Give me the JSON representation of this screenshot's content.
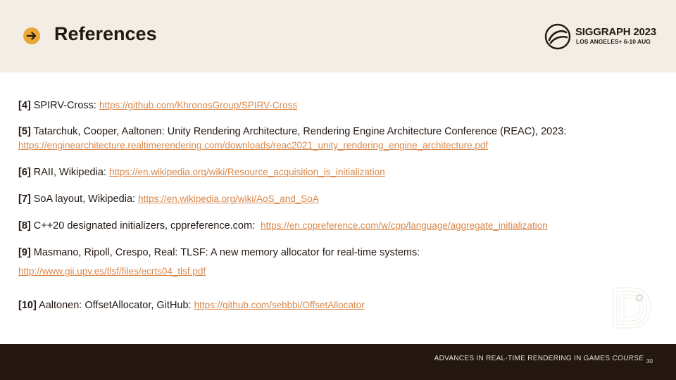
{
  "header": {
    "title": "References",
    "logo_name": "SIGGRAPH 2023",
    "logo_sub": "LOS ANGELES+ 6-10 AUG"
  },
  "colors": {
    "header_bg": "#f4ede5",
    "accent": "#e8a838",
    "link": "#d9874a",
    "footer_bg": "#231710"
  },
  "references": [
    {
      "num": "[4]",
      "text": "SPIRV-Cross:",
      "link": "https://github.com/KhronosGroup/SPIRV-Cross"
    },
    {
      "num": "[5]",
      "text": "Tatarchuk, Cooper, Aaltonen: Unity Rendering Architecture, Rendering Engine Architecture Conference (REAC), 2023:",
      "link": "https://enginearchitecture.realtimerendering.com/downloads/reac2021_unity_rendering_engine_architecture.pdf"
    },
    {
      "num": "[6]",
      "text": "RAII, Wikipedia:",
      "link": "https://en.wikipedia.org/wiki/Resource_acquisition_is_initialization"
    },
    {
      "num": "[7]",
      "text": "SoA layout, Wikipedia:",
      "link": "https://en.wikipedia.org/wiki/AoS_and_SoA"
    },
    {
      "num": "[8]",
      "text": "C++20 designated initializers, cppreference.com:",
      "link": "https://en.cppreference.com/w/cpp/language/aggregate_initialization"
    },
    {
      "num": "[9]",
      "text": "Masmano, Ripoll, Crespo, Real: TLSF: A new memory allocator for real-time systems:",
      "link": "http://www.gii.upv.es/tlsf/files/ecrts04_tlsf.pdf"
    },
    {
      "num": "[10]",
      "text": "Aaltonen: OffsetAllocator, GitHub:",
      "link": "https://github.com/sebbbi/OffsetAllocator"
    }
  ],
  "footer": {
    "course_text": "ADVANCES IN REAL-TIME RENDERING IN GAMES",
    "course_word": "COURSE",
    "page_number": "30"
  }
}
